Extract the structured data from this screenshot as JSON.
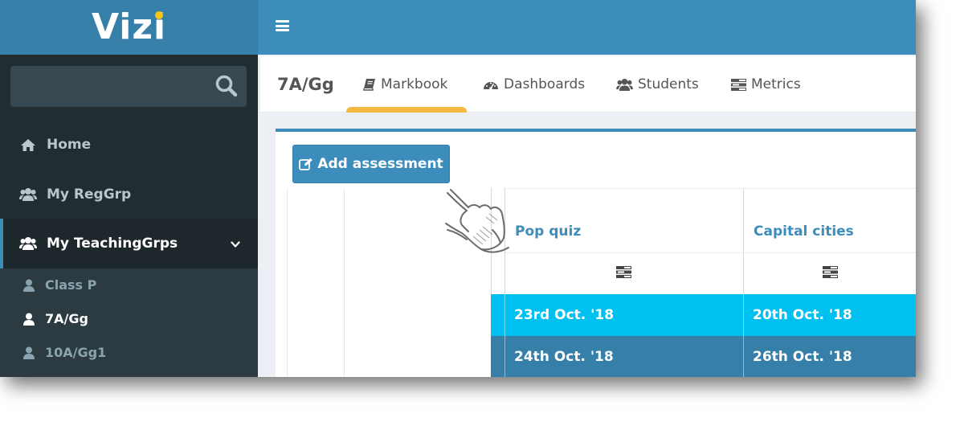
{
  "app": {
    "logo_text": "Vizi",
    "brand_color": "#3c8dbc",
    "accent_dot_color": "#f5c518"
  },
  "sidebar": {
    "search": {
      "placeholder": "",
      "icon": "search-icon"
    },
    "items": [
      {
        "label": "Home",
        "icon": "home-icon"
      },
      {
        "label": "My RegGrp",
        "icon": "users-icon"
      },
      {
        "label": "My TeachingGrps",
        "icon": "users-icon",
        "expanded": true
      }
    ],
    "subitems": [
      {
        "label": "Class P",
        "icon": "user-icon"
      },
      {
        "label": "7A/Gg",
        "icon": "user-icon",
        "active": true
      },
      {
        "label": "10A/Gg1",
        "icon": "user-icon"
      }
    ]
  },
  "header": {
    "menu_icon": "hamburger-icon"
  },
  "tabs": {
    "group_title": "7A/Gg",
    "items": [
      {
        "label": "Markbook",
        "icon": "book-icon",
        "active": true
      },
      {
        "label": "Dashboards",
        "icon": "dashboard-icon"
      },
      {
        "label": "Students",
        "icon": "users-icon"
      },
      {
        "label": "Metrics",
        "icon": "list-icon"
      }
    ]
  },
  "main": {
    "add_button_label": "Add assessment",
    "assessments": [
      {
        "name": "Pop quiz",
        "dates": [
          "23rd Oct. '18",
          "24th Oct. '18"
        ]
      },
      {
        "name": "Capital cities",
        "dates": [
          "20th Oct. '18",
          "26th Oct. '18"
        ]
      }
    ],
    "row_colors": [
      "#00c0ef",
      "#367fa9"
    ]
  }
}
